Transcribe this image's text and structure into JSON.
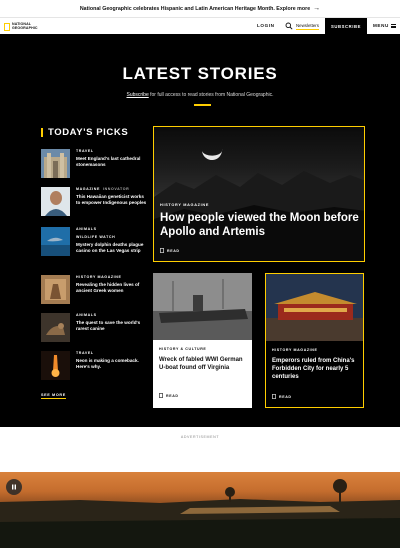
{
  "promo": {
    "text": "National Geographic celebrates Hispanic and Latin American Heritage Month. Explore more"
  },
  "header": {
    "logo_line1": "NATIONAL",
    "logo_line2": "GEOGRAPHIC",
    "login": "LOGIN",
    "newsletters": "Newsletters",
    "subscribe": "SUBSCRIBE",
    "menu": "MENU"
  },
  "hero": {
    "title": "LATEST STORIES",
    "subscribe_link": "Subscribe",
    "subtitle_rest": " for full access to read stories from National Geographic."
  },
  "picks": {
    "heading": "TODAY'S PICKS",
    "items": [
      {
        "kicker": "TRAVEL",
        "headline": "Meet England's last cathedral stonemasons"
      },
      {
        "kicker": "MAGAZINE",
        "kicker_sub": "INNOVATOR",
        "headline": "This Hawaiian geneticist works to empower Indigenous peoples"
      },
      {
        "kicker": "ANIMALS",
        "kicker2": "WILDLIFE WATCH",
        "headline": "Mystery dolphin deaths plague casino on the Las Vegas strip"
      },
      {
        "kicker": "HISTORY MAGAZINE",
        "headline": "Revealing the hidden lives of ancient Greek women"
      },
      {
        "kicker": "ANIMALS",
        "headline": "The quest to save the world's rarest canine"
      },
      {
        "kicker": "TRAVEL",
        "headline": "Neon is making a comeback. Here's why."
      }
    ],
    "see_more": "SEE MORE"
  },
  "feature": {
    "kicker": "HISTORY MAGAZINE",
    "headline": "How people viewed the Moon before Apollo and Artemis",
    "read": "READ"
  },
  "cards": [
    {
      "kicker": "HISTORY & CULTURE",
      "headline": "Wreck of fabled WWI German U-boat found off Virginia",
      "read": "READ"
    },
    {
      "kicker": "HISTORY MAGAZINE",
      "headline": "Emperors ruled from China's Forbidden City for nearly 5 centuries",
      "read": "READ"
    }
  ],
  "ad": {
    "label": "ADVERTISEMENT"
  },
  "colors": {
    "accent": "#ffce00",
    "background": "#000000"
  }
}
